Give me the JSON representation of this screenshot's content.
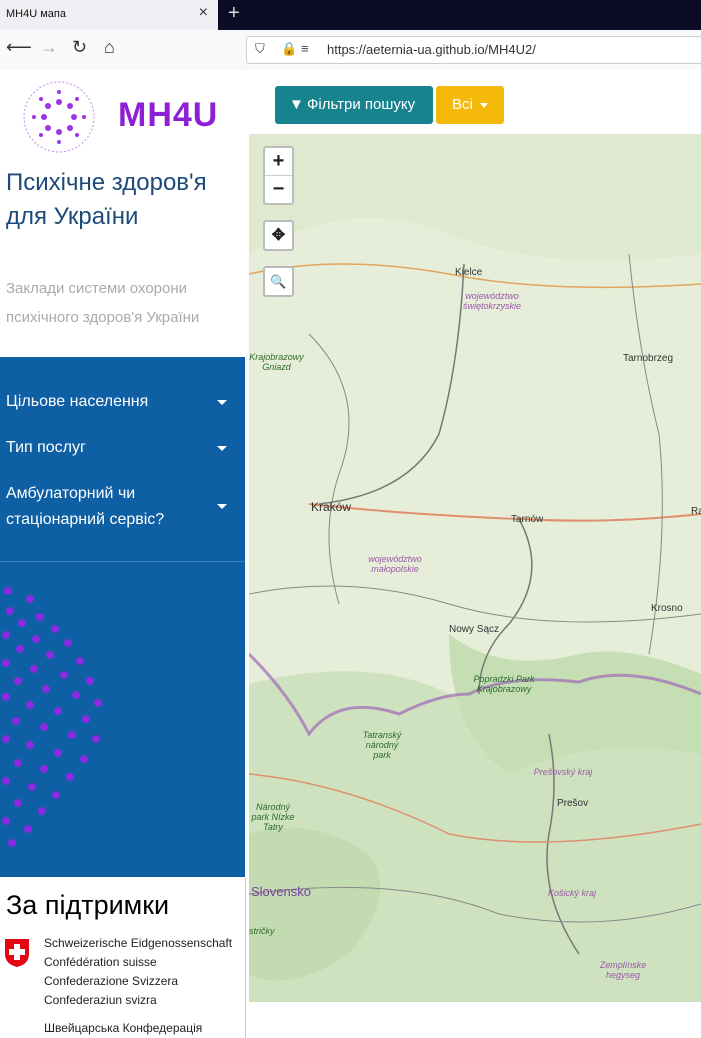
{
  "browser": {
    "tab_title": "MH4U мапа",
    "tab_close": "×",
    "new_tab": "+",
    "url": "https://aeternia-ua.github.io/MH4U2/"
  },
  "sidebar": {
    "logo_text": "MH4U",
    "title": "Психічне здоров'я для України",
    "subtitle": "Заклади системи охорони психічного здоров'я України",
    "menu": [
      {
        "label": "Цільове населення"
      },
      {
        "label": "Тип послуг"
      },
      {
        "label": "Амбулаторний чи стаціонарний сервіс?"
      }
    ],
    "support_title": "За підтримки",
    "swiss_lines": [
      "Schweizerische Eidgenossenschaft",
      "Confédération suisse",
      "Confederazione Svizzera",
      "Confederaziun svizra"
    ],
    "swiss_ua": "Швейцарська Конфедерація"
  },
  "toolbar": {
    "filter_label": "Фільтри пошуку",
    "all_label": "Всі"
  },
  "map": {
    "controls": {
      "zoom_in": "+",
      "zoom_out": "−",
      "locate": "✥",
      "search": "🔍"
    },
    "places": {
      "kielce": "Kielce",
      "tarnobrzeg": "Tarnobrzeg",
      "krakow": "Kraków",
      "tarnow": "Tarnów",
      "krosno": "Krosno",
      "nowy_sacz": "Nowy Sącz",
      "presov": "Prešov",
      "ra": "Ra"
    },
    "regions": {
      "swietokrzyskie": "województwo świętokrzyskie",
      "malopolskie": "województwo małopolskie",
      "presovsky": "Prešovský kraj",
      "kosicky": "Košický kraj",
      "zemplin": "Zemplínske hegyseg"
    },
    "parks": {
      "popradzki": "Popradzki Park Krajobrazowy",
      "tatransky": "Tatranský národný park",
      "nizke_tatry": "Národný park Nízke Tatry",
      "jurajski": "Krajobrazowy Gniazd",
      "stricky": "stričky"
    },
    "country": "Slovensko"
  },
  "colors": {
    "accent_purple": "#8e1fd6",
    "menu_blue": "#0e5fa3",
    "teal": "#17838e",
    "amber": "#f5b90a"
  }
}
